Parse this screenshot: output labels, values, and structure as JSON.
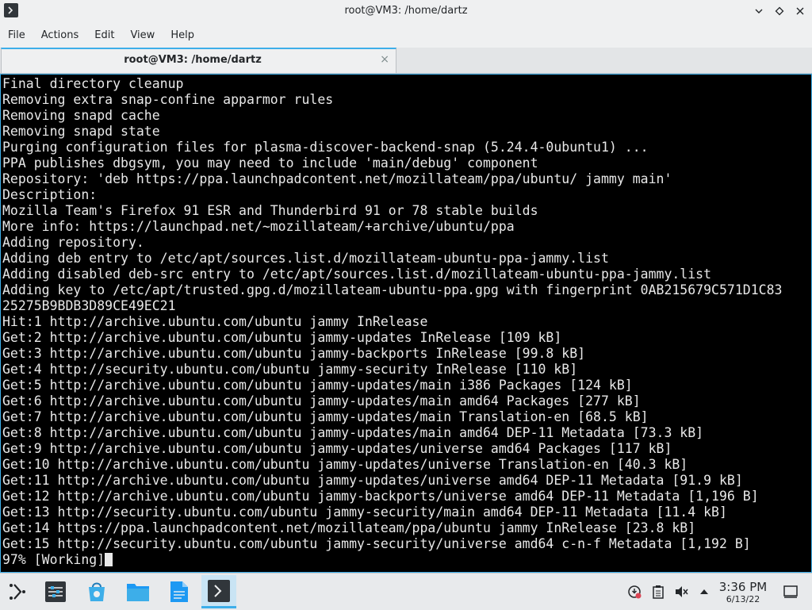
{
  "window": {
    "title": "root@VM3: /home/dartz",
    "controls": [
      "minimize-icon",
      "maximize-icon",
      "close-icon"
    ]
  },
  "menu": [
    "File",
    "Actions",
    "Edit",
    "View",
    "Help"
  ],
  "tab": {
    "label": "root@VM3: /home/dartz",
    "close": "×"
  },
  "terminal": {
    "lines": [
      "Final directory cleanup",
      "Removing extra snap-confine apparmor rules",
      "Removing snapd cache",
      "Removing snapd state",
      "Purging configuration files for plasma-discover-backend-snap (5.24.4-0ubuntu1) ...",
      "PPA publishes dbgsym, you may need to include 'main/debug' component",
      "Repository: 'deb https://ppa.launchpadcontent.net/mozillateam/ppa/ubuntu/ jammy main'",
      "Description:",
      "Mozilla Team's Firefox 91 ESR and Thunderbird 91 or 78 stable builds",
      "More info: https://launchpad.net/~mozillateam/+archive/ubuntu/ppa",
      "Adding repository.",
      "Adding deb entry to /etc/apt/sources.list.d/mozillateam-ubuntu-ppa-jammy.list",
      "Adding disabled deb-src entry to /etc/apt/sources.list.d/mozillateam-ubuntu-ppa-jammy.list",
      "Adding key to /etc/apt/trusted.gpg.d/mozillateam-ubuntu-ppa.gpg with fingerprint 0AB215679C571D1C83",
      "25275B9BDB3D89CE49EC21",
      "Hit:1 http://archive.ubuntu.com/ubuntu jammy InRelease",
      "Get:2 http://archive.ubuntu.com/ubuntu jammy-updates InRelease [109 kB]",
      "Get:3 http://archive.ubuntu.com/ubuntu jammy-backports InRelease [99.8 kB]",
      "Get:4 http://security.ubuntu.com/ubuntu jammy-security InRelease [110 kB]",
      "Get:5 http://archive.ubuntu.com/ubuntu jammy-updates/main i386 Packages [124 kB]",
      "Get:6 http://archive.ubuntu.com/ubuntu jammy-updates/main amd64 Packages [277 kB]",
      "Get:7 http://archive.ubuntu.com/ubuntu jammy-updates/main Translation-en [68.5 kB]",
      "Get:8 http://archive.ubuntu.com/ubuntu jammy-updates/main amd64 DEP-11 Metadata [73.3 kB]",
      "Get:9 http://archive.ubuntu.com/ubuntu jammy-updates/universe amd64 Packages [117 kB]",
      "Get:10 http://archive.ubuntu.com/ubuntu jammy-updates/universe Translation-en [40.3 kB]",
      "Get:11 http://archive.ubuntu.com/ubuntu jammy-updates/universe amd64 DEP-11 Metadata [91.9 kB]",
      "Get:12 http://archive.ubuntu.com/ubuntu jammy-backports/universe amd64 DEP-11 Metadata [1,196 B]",
      "Get:13 http://security.ubuntu.com/ubuntu jammy-security/main amd64 DEP-11 Metadata [11.4 kB]",
      "Get:14 https://ppa.launchpadcontent.net/mozillateam/ppa/ubuntu jammy InRelease [23.8 kB]",
      "Get:15 http://security.ubuntu.com/ubuntu jammy-security/universe amd64 c-n-f Metadata [1,192 B]"
    ],
    "prompt_line": "97% [Working]"
  },
  "taskbar": {
    "items": [
      "application-launcher-icon",
      "system-settings-icon",
      "discover-store-icon",
      "file-manager-icon",
      "text-editor-icon",
      "konsole-terminal-icon"
    ],
    "tray": [
      "updates-icon",
      "clipboard-icon",
      "volume-muted-icon",
      "show-hidden-icons-icon"
    ],
    "clock_time": "3:36 PM",
    "clock_date": "6/13/22"
  },
  "colors": {
    "accent": "#3daee9",
    "terminal_bg": "#000000",
    "terminal_fg": "#e8e8e8",
    "panel_bg": "#eff0f1"
  }
}
